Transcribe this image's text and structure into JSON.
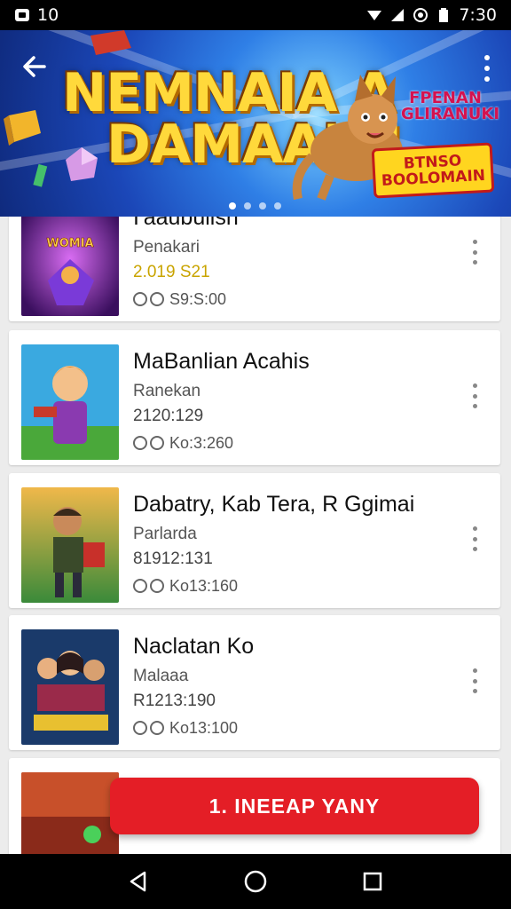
{
  "status_bar": {
    "time": "7:30",
    "left_indicator": "10"
  },
  "banner": {
    "title_line1": "NEMNAIA A",
    "title_line2": "DAMAAIAI",
    "subtitle_line1": "FPENAN",
    "subtitle_line2": "GLIRANUKI",
    "badge_line1": "BTNSO",
    "badge_line2": "BOOLOMAIN",
    "page_dots": 4
  },
  "list": {
    "items": [
      {
        "title": "I'aaubuiish",
        "subtitle": "Penakari",
        "date": "2.019 S21",
        "meta": "S9:S:00"
      },
      {
        "title": "MaBanlian Acahis",
        "subtitle": "Ranekan",
        "date": "2120:129",
        "meta": "Ko:3:260"
      },
      {
        "title": "Dabatry, Kab Tera, R Ggimai",
        "subtitle": "Parlarda",
        "date": "81912:131",
        "meta": "Ko13:160"
      },
      {
        "title": "Naclatan Ko",
        "subtitle": "Malaaa",
        "date": "R1213:190",
        "meta": "Ko13:100"
      }
    ]
  },
  "cta": {
    "label": "1. INEEAP YANY"
  },
  "colors": {
    "accent": "#e41e26",
    "banner_blue": "#1b47b8",
    "gold": "#c9a400"
  },
  "icons": {
    "back": "arrow-left-icon",
    "menu": "more-vertical-icon",
    "nav_back": "triangle-back-icon",
    "nav_home": "circle-home-icon",
    "nav_recents": "square-recents-icon"
  }
}
